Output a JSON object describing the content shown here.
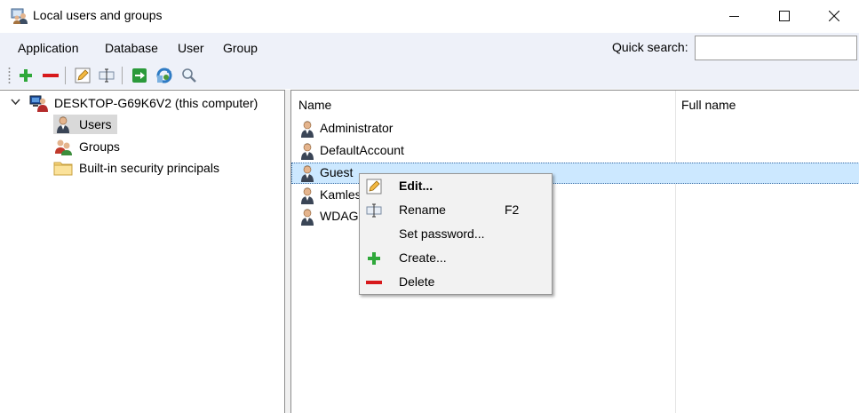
{
  "window": {
    "title": "Local users and groups",
    "icon": "users-groups-icon",
    "controls": [
      "minimize-icon",
      "maximize-icon",
      "close-icon"
    ]
  },
  "menubar": {
    "items": [
      "Application",
      "Database",
      "User",
      "Group"
    ],
    "quick_search_label": "Quick search:",
    "quick_search_value": ""
  },
  "toolbar": {
    "buttons": [
      "add-icon",
      "remove-icon",
      "edit-icon",
      "rename-icon",
      "export-icon",
      "refresh-icon",
      "search-icon"
    ]
  },
  "tree": {
    "root": "DESKTOP-G69K6V2 (this computer)",
    "children": [
      "Users",
      "Groups",
      "Built-in security principals"
    ],
    "selected": "Users"
  },
  "list": {
    "columns": [
      "Name",
      "Full name"
    ],
    "rows": [
      {
        "name": "Administrator",
        "full_name": ""
      },
      {
        "name": "DefaultAccount",
        "full_name": ""
      },
      {
        "name": "Guest",
        "full_name": ""
      },
      {
        "name": "Kamles",
        "full_name": ""
      },
      {
        "name": "WDAGU",
        "full_name": ""
      }
    ],
    "selected_row": "Guest"
  },
  "context_menu": {
    "items": [
      {
        "label": "Edit...",
        "shortcut": "",
        "icon": "edit-icon",
        "bold": true
      },
      {
        "label": "Rename",
        "shortcut": "F2",
        "icon": "rename-icon",
        "bold": false
      },
      {
        "label": "Set password...",
        "shortcut": "",
        "icon": "",
        "bold": false
      },
      {
        "label": "Create...",
        "shortcut": "",
        "icon": "add-icon",
        "bold": false
      },
      {
        "label": "Delete",
        "shortcut": "",
        "icon": "remove-icon",
        "bold": false
      }
    ]
  },
  "colors": {
    "menubar_bg": "#eef1f9",
    "selection_bg": "#cce8ff",
    "tree_selection_bg": "#d9d9d9",
    "add_green": "#2fa83a",
    "remove_red": "#d7191c"
  }
}
